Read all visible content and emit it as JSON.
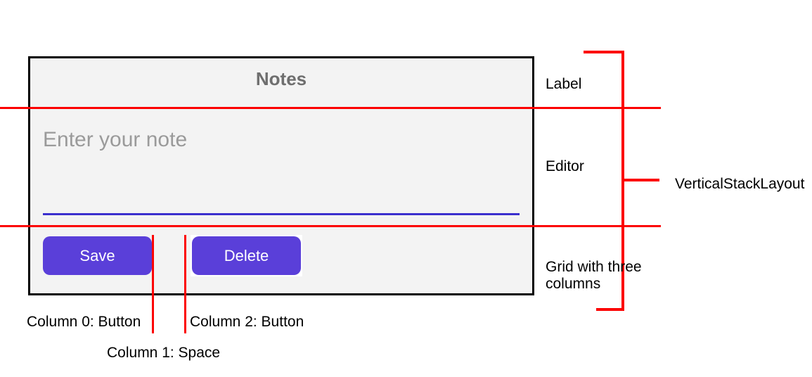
{
  "app": {
    "title": "Notes"
  },
  "editor": {
    "placeholder": "Enter your note"
  },
  "buttons": {
    "save": "Save",
    "delete": "Delete"
  },
  "annotations": {
    "label": "Label",
    "editor": "Editor",
    "grid": "Grid with three columns",
    "vsl": "VerticalStackLayout",
    "col0": "Column 0: Button",
    "col1": "Column 1: Space",
    "col2": "Column 2: Button"
  }
}
